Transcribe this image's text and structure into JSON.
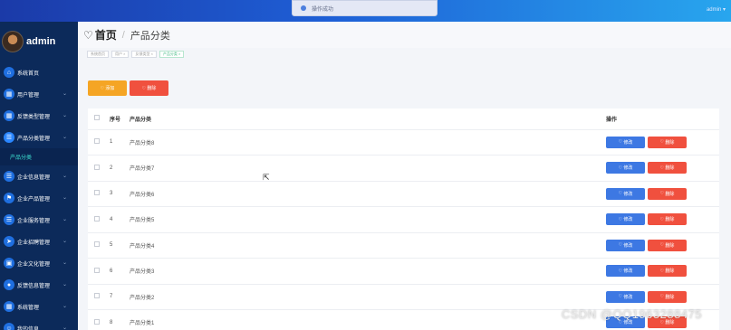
{
  "toast": {
    "message": "操作成功"
  },
  "user_menu": {
    "label": "admin ▾"
  },
  "sidebar": {
    "brand": "admin",
    "items": [
      {
        "label": "系统首页",
        "icon": "home-icon",
        "glyph": "⌂",
        "chevron": false
      },
      {
        "label": "用户管理",
        "icon": "grid-icon",
        "glyph": "▦",
        "chevron": true
      },
      {
        "label": "反馈类型管理",
        "icon": "grid-icon",
        "glyph": "▦",
        "chevron": true
      },
      {
        "label": "产品分类管理",
        "icon": "list-icon",
        "glyph": "☰",
        "chevron": true,
        "active": true
      },
      {
        "label": "企业信息管理",
        "icon": "list-icon",
        "glyph": "☰",
        "chevron": true
      },
      {
        "label": "企业产品管理",
        "icon": "flag-icon",
        "glyph": "⚑",
        "chevron": true
      },
      {
        "label": "企业服务管理",
        "icon": "list-icon",
        "glyph": "☰",
        "chevron": true
      },
      {
        "label": "企业招聘管理",
        "icon": "send-icon",
        "glyph": "➤",
        "chevron": true
      },
      {
        "label": "企业文化管理",
        "icon": "briefcase-icon",
        "glyph": "▣",
        "chevron": true
      },
      {
        "label": "反馈信息管理",
        "icon": "user-icon",
        "glyph": "●",
        "chevron": true
      },
      {
        "label": "系统管理",
        "icon": "grid-icon",
        "glyph": "▦",
        "chevron": true
      },
      {
        "label": "我的信息",
        "icon": "person-icon",
        "glyph": "☺",
        "chevron": true
      }
    ],
    "sub_item": "产品分类"
  },
  "header": {
    "title": "首页",
    "breadcrumb": "产品分类"
  },
  "tags": [
    "系统首页",
    "用户 ×",
    "反馈类型 ×",
    "产品分类 ×"
  ],
  "toolbar": {
    "add_label": "添加",
    "delete_label": "删除"
  },
  "table": {
    "columns": [
      "序号",
      "产品分类",
      "操作"
    ],
    "rows": [
      {
        "no": "1",
        "name": "产品分类8"
      },
      {
        "no": "2",
        "name": "产品分类7"
      },
      {
        "no": "3",
        "name": "产品分类6"
      },
      {
        "no": "4",
        "name": "产品分类5"
      },
      {
        "no": "5",
        "name": "产品分类4"
      },
      {
        "no": "6",
        "name": "产品分类3"
      },
      {
        "no": "7",
        "name": "产品分类2"
      },
      {
        "no": "8",
        "name": "产品分类1"
      }
    ],
    "edit_label": "修改",
    "delete_label": "删除"
  },
  "watermark": "CSDN @QQ1963288475"
}
